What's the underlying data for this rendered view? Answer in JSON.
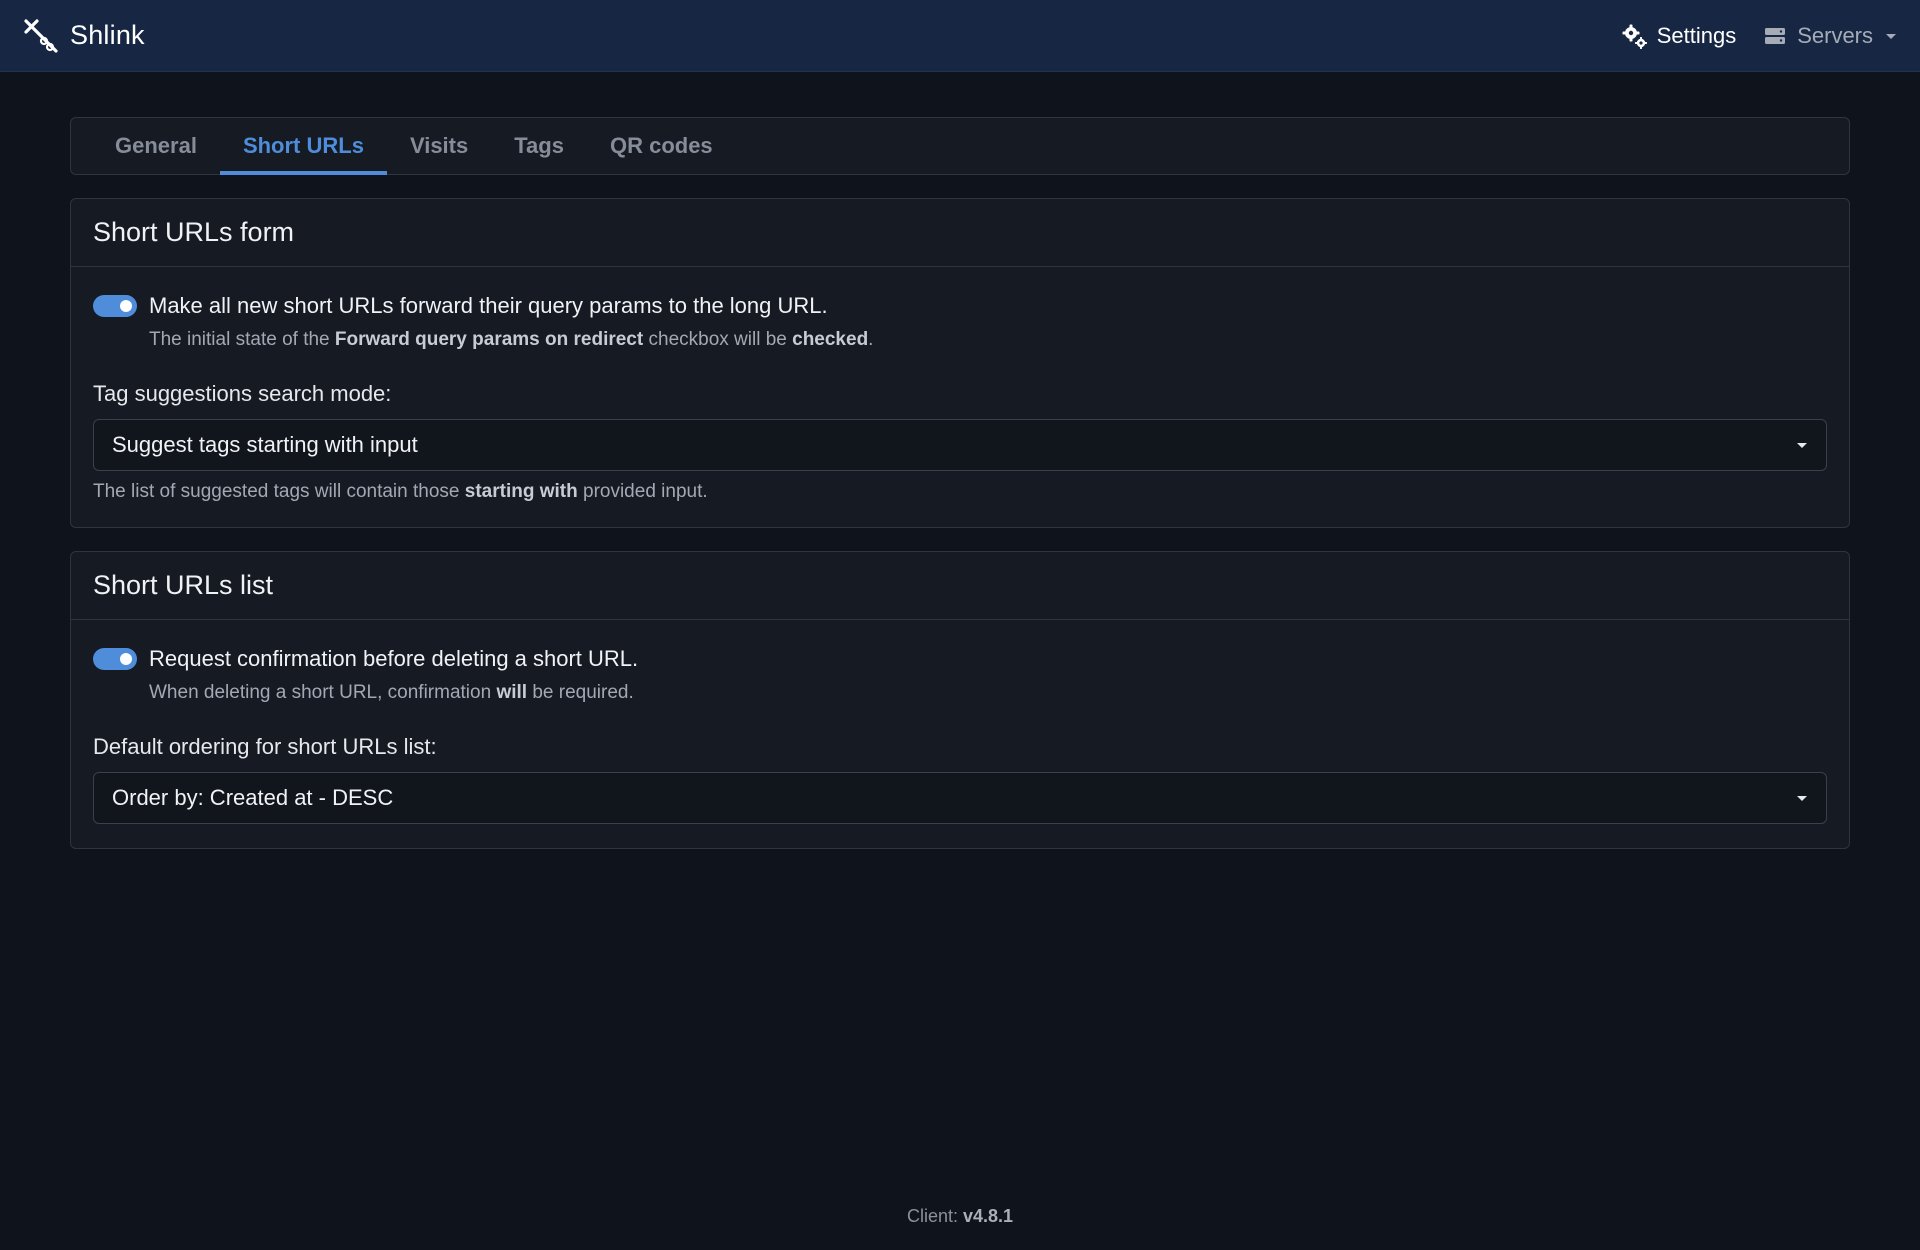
{
  "app": {
    "name": "Shlink"
  },
  "navbar": {
    "settings_label": "Settings",
    "servers_label": "Servers"
  },
  "tabs": [
    {
      "label": "General",
      "active": false
    },
    {
      "label": "Short URLs",
      "active": true
    },
    {
      "label": "Visits",
      "active": false
    },
    {
      "label": "Tags",
      "active": false
    },
    {
      "label": "QR codes",
      "active": false
    }
  ],
  "short_urls_form": {
    "title": "Short URLs form",
    "forward_query": {
      "enabled": true,
      "label": "Make all new short URLs forward their query params to the long URL.",
      "help_prefix": "The initial state of the ",
      "help_bold1": "Forward query params on redirect",
      "help_mid": " checkbox will be ",
      "help_bold2": "checked",
      "help_suffix": "."
    },
    "tag_mode": {
      "label": "Tag suggestions search mode:",
      "value": "Suggest tags starting with input",
      "help_prefix": "The list of suggested tags will contain those ",
      "help_bold": "starting with",
      "help_suffix": " provided input."
    }
  },
  "short_urls_list": {
    "title": "Short URLs list",
    "confirm_delete": {
      "enabled": true,
      "label": "Request confirmation before deleting a short URL.",
      "help_prefix": "When deleting a short URL, confirmation ",
      "help_bold": "will",
      "help_suffix": " be required."
    },
    "ordering": {
      "label": "Default ordering for short URLs list:",
      "value": "Order by: Created at - DESC"
    }
  },
  "footer": {
    "prefix": "Client: ",
    "version": "v4.8.1"
  },
  "colors": {
    "navbar_bg": "#172743",
    "page_bg": "#0f131b",
    "accent": "#4f8ddb"
  }
}
